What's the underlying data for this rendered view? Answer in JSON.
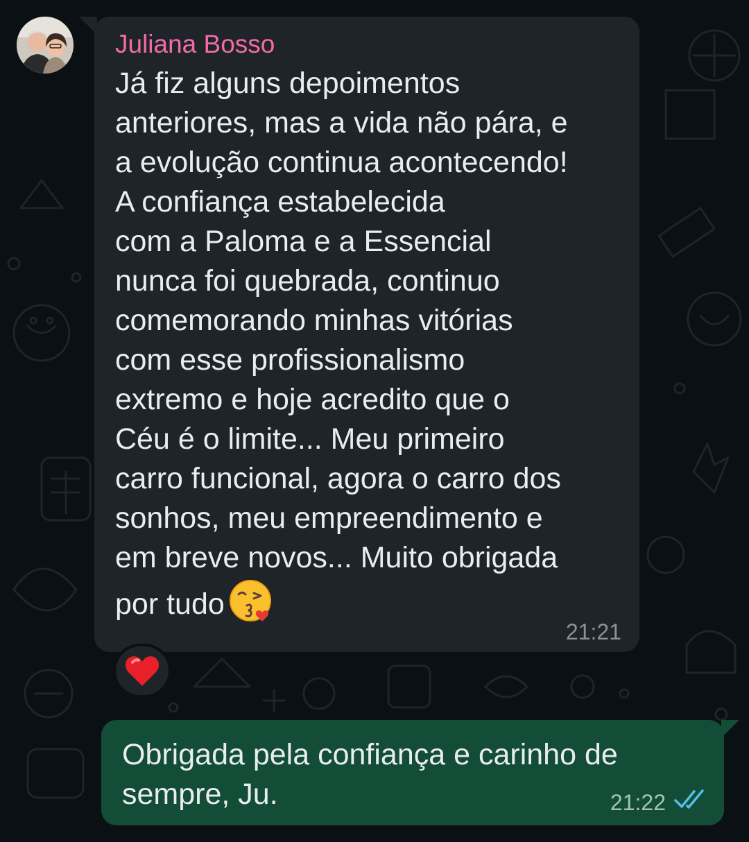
{
  "chat": {
    "incoming": {
      "sender": "Juliana Bosso",
      "text": "Já fiz alguns depoimentos\nanteriores, mas a vida não pára, e\na evolução continua acontecendo!\nA confiança estabelecida\ncom a Paloma e a Essencial\nnunca foi quebrada, continuo\ncomemorando minhas vitórias\ncom esse profissionalismo\nextremo e hoje acredito que o\nCéu é o limite... Meu primeiro\ncarro funcional, agora o carro dos\nsonhos, meu empreendimento e\nem breve novos... Muito obrigada\npor tudo",
      "emoji_icon": "face-blowing-kiss-emoji",
      "time": "21:21",
      "reaction_icon": "red-heart-emoji"
    },
    "outgoing": {
      "text": "Obrigada pela confiança e carinho de\nsempre, Ju.",
      "time": "21:22",
      "status_icon": "double-check-read-icon"
    }
  },
  "colors": {
    "background": "#0b1014",
    "incoming_bubble": "#1f2428",
    "outgoing_bubble": "#134d37",
    "sender_name": "#f26ba9",
    "read_ticks": "#53bdeb",
    "message_text": "#e9edef"
  }
}
